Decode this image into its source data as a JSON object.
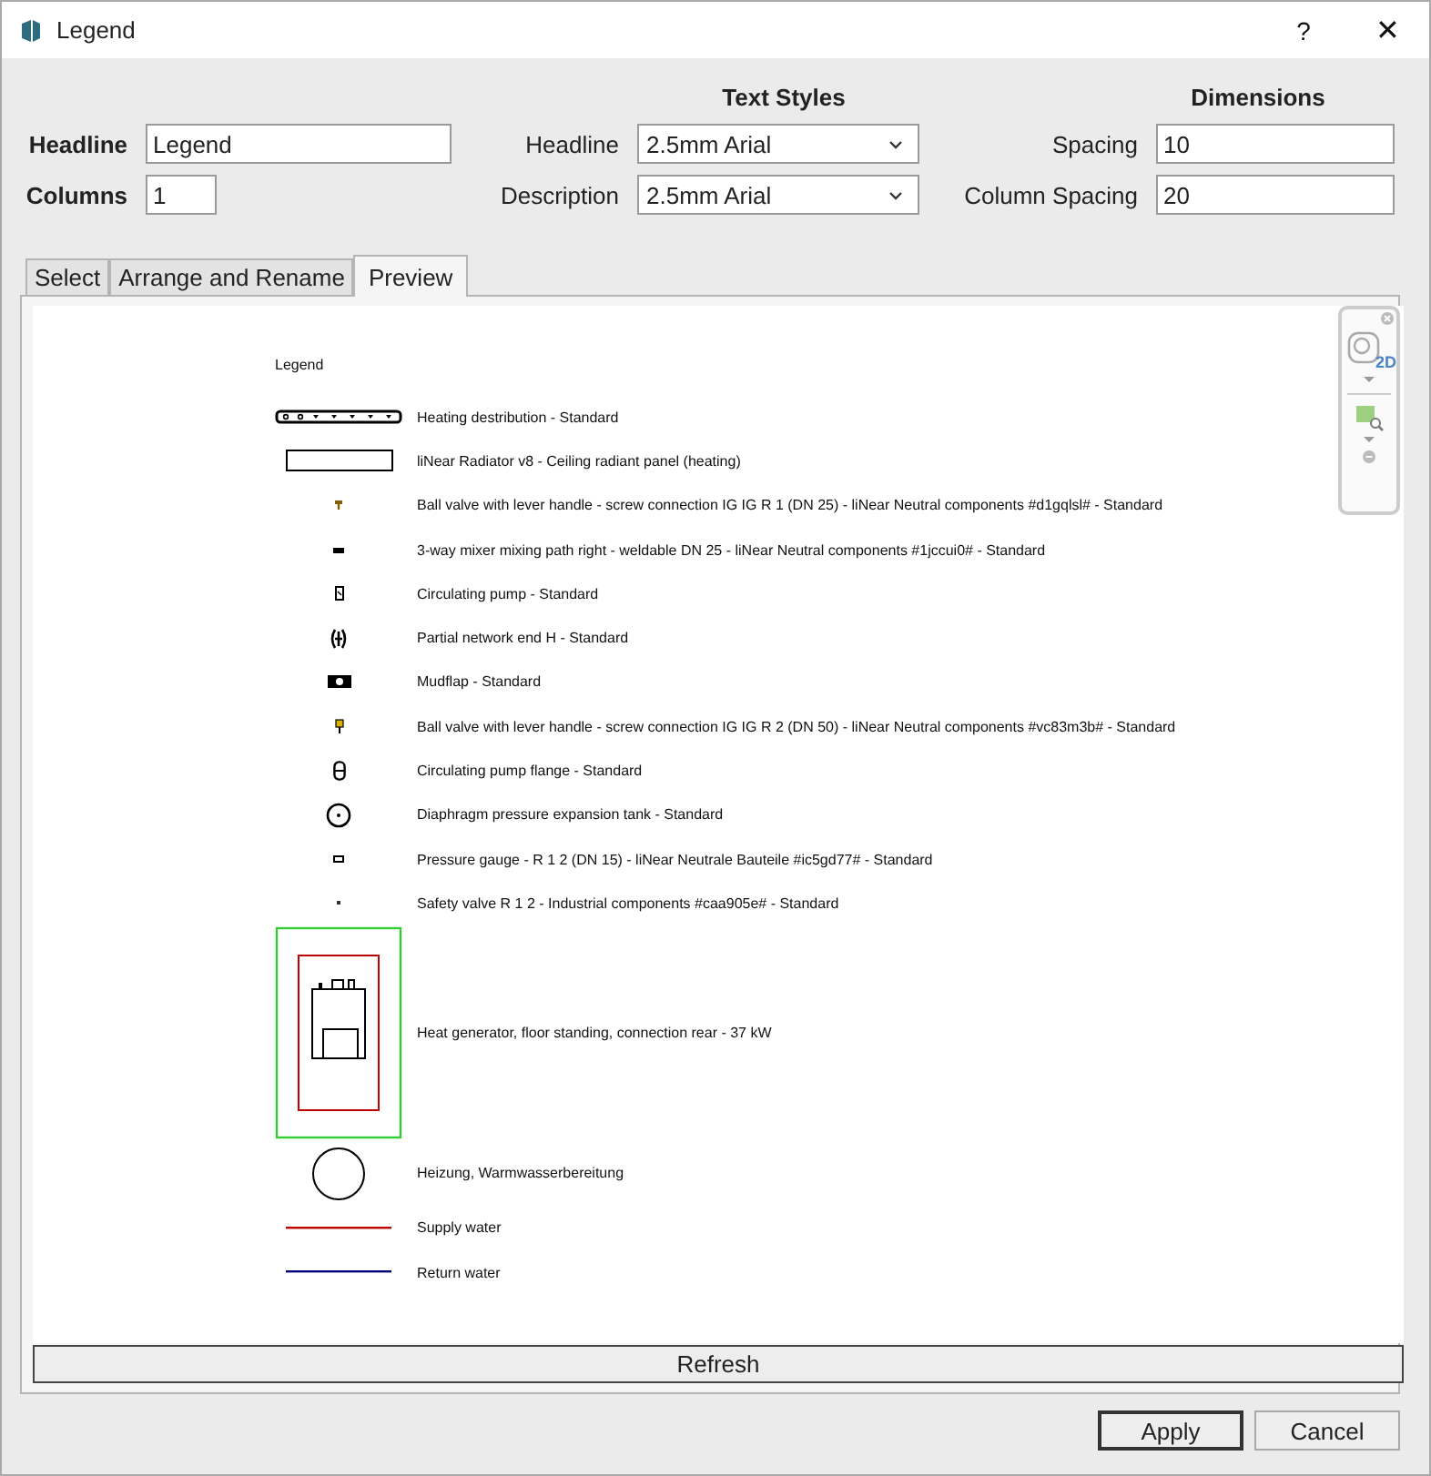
{
  "window": {
    "title": "Legend",
    "help": "?",
    "close": "✕"
  },
  "form": {
    "headline_label": "Headline",
    "headline_value": "Legend",
    "columns_label": "Columns",
    "columns_value": "1",
    "text_styles": {
      "heading": "Text Styles",
      "rows": [
        {
          "label": "Headline",
          "value": "2.5mm Arial"
        },
        {
          "label": "Description",
          "value": "2.5mm Arial"
        }
      ]
    },
    "dimensions": {
      "heading": "Dimensions",
      "rows": [
        {
          "label": "Spacing",
          "value": "10"
        },
        {
          "label": "Column Spacing",
          "value": "20"
        }
      ]
    }
  },
  "tabs": [
    {
      "label": "Select",
      "selected": false
    },
    {
      "label": "Arrange and Rename",
      "selected": false
    },
    {
      "label": "Preview",
      "selected": true
    }
  ],
  "preview": {
    "title": "Legend",
    "nav_label": "2D",
    "entries": [
      {
        "kind": "pipe",
        "text": "Heating destribution - Standard"
      },
      {
        "kind": "panel",
        "text": "liNear Radiator v8 - Ceiling radiant panel (heating)"
      },
      {
        "kind": "valve",
        "text": "Ball valve with lever handle - screw connection IG IG R 1 (DN 25) - liNear Neutral components #d1gqlsl# - Standard"
      },
      {
        "kind": "mixer",
        "text": "3-way mixer mixing path right - weldable DN 25 - liNear Neutral components #1jccui0# - Standard"
      },
      {
        "kind": "pump",
        "text": "Circulating pump - Standard"
      },
      {
        "kind": "network_end",
        "text": "Partial network end H - Standard"
      },
      {
        "kind": "mudflap",
        "text": "Mudflap - Standard"
      },
      {
        "kind": "valve_large",
        "text": "Ball valve with lever handle - screw connection IG IG R 2 (DN 50) - liNear Neutral components #vc83m3b# - Standard"
      },
      {
        "kind": "pump_flange",
        "text": "Circulating pump flange - Standard"
      },
      {
        "kind": "tank",
        "text": "Diaphragm pressure expansion tank - Standard"
      },
      {
        "kind": "gauge",
        "text": "Pressure gauge - R 1 2 (DN 15) - liNear Neutrale Bauteile #ic5gd77# - Standard"
      },
      {
        "kind": "safety_valve",
        "text": "Safety valve R 1 2 - Industrial components #caa905e# - Standard"
      },
      {
        "kind": "boiler",
        "text": "Heat generator, floor standing, connection rear - 37 kW"
      },
      {
        "kind": "circle",
        "text": "Heizung, Warmwasserbereitung"
      },
      {
        "kind": "line",
        "color": "#c00000",
        "text": "Supply water"
      },
      {
        "kind": "line",
        "color": "#000080",
        "text": "Return water"
      }
    ]
  },
  "refresh": "Refresh",
  "buttons": [
    {
      "label": "Apply",
      "default": true
    },
    {
      "label": "Cancel",
      "default": false
    }
  ]
}
